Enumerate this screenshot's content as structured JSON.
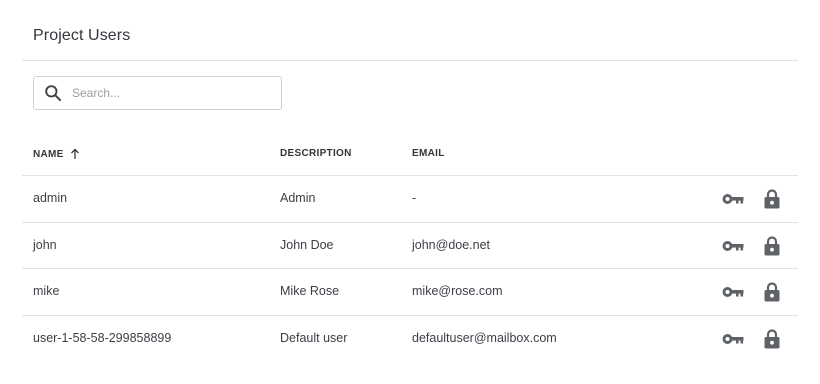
{
  "header": {
    "title": "Project Users"
  },
  "search": {
    "placeholder": "Search...",
    "value": "",
    "icon": "search-icon"
  },
  "table": {
    "columns": [
      {
        "label": "NAME",
        "sort": "ascending",
        "sort_icon": "arrow-up-icon"
      },
      {
        "label": "DESCRIPTION"
      },
      {
        "label": "EMAIL"
      }
    ],
    "rows": [
      {
        "name": "admin",
        "description": "Admin",
        "email": "-",
        "actions": [
          "key-icon",
          "lock-icon"
        ]
      },
      {
        "name": "john",
        "description": "John Doe",
        "email": "john@doe.net",
        "actions": [
          "key-icon",
          "lock-icon"
        ]
      },
      {
        "name": "mike",
        "description": "Mike Rose",
        "email": "mike@rose.com",
        "actions": [
          "key-icon",
          "lock-icon"
        ]
      },
      {
        "name": "user-1-58-58-299858899",
        "description": "Default user",
        "email": "defaultuser@mailbox.com",
        "actions": [
          "key-icon",
          "lock-icon"
        ]
      }
    ]
  },
  "colors": {
    "text": "#3d4047",
    "icon": "#5f6368",
    "divider": "#e2e3e6"
  }
}
